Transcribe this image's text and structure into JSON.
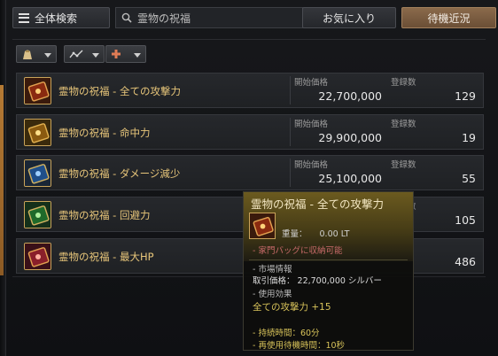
{
  "topbar": {
    "all_search_label": "全体検索",
    "search_value": "霊物の祝福",
    "favorites_label": "お気に入り",
    "waiting_label": "待機近況"
  },
  "filters": [
    {
      "icon": "bag-icon"
    },
    {
      "icon": "trend-icon"
    },
    {
      "icon": "plus-icon"
    }
  ],
  "labels": {
    "start_price": "開始価格",
    "registered_count": "登録数"
  },
  "rows": [
    {
      "name": "霊物の祝福 - 全ての攻撃力",
      "price": "22,700,000",
      "count": "129",
      "icon_color": "#8a2a10"
    },
    {
      "name": "霊物の祝福 - 命中力",
      "price": "29,900,000",
      "count": "19",
      "icon_color": "#8a5a10"
    },
    {
      "name": "霊物の祝福 - ダメージ減少",
      "price": "25,100,000",
      "count": "55",
      "icon_color": "#1f4f8a"
    },
    {
      "name": "霊物の祝福 - 回避力",
      "price": "",
      "count": "105",
      "icon_color": "#1f6a2a"
    },
    {
      "name": "霊物の祝福 - 最大HP",
      "price": "",
      "count": "486",
      "icon_color": "#8a1f2a"
    }
  ],
  "tooltip": {
    "title": "霊物の祝福 - 全ての攻撃力",
    "weight_label": "重量：",
    "weight_value": "0.00 LT",
    "storage_note": "- 家門バッグに収納可能",
    "market_header": "- 市場情報",
    "trade_price": "取引価格： 22,700,000 シルバー",
    "use_effect_header": "- 使用効果",
    "effect": "全ての攻撃力 +15",
    "duration": "- 持続時間：60分",
    "cooldown": "- 再使用待機時間：10秒"
  }
}
